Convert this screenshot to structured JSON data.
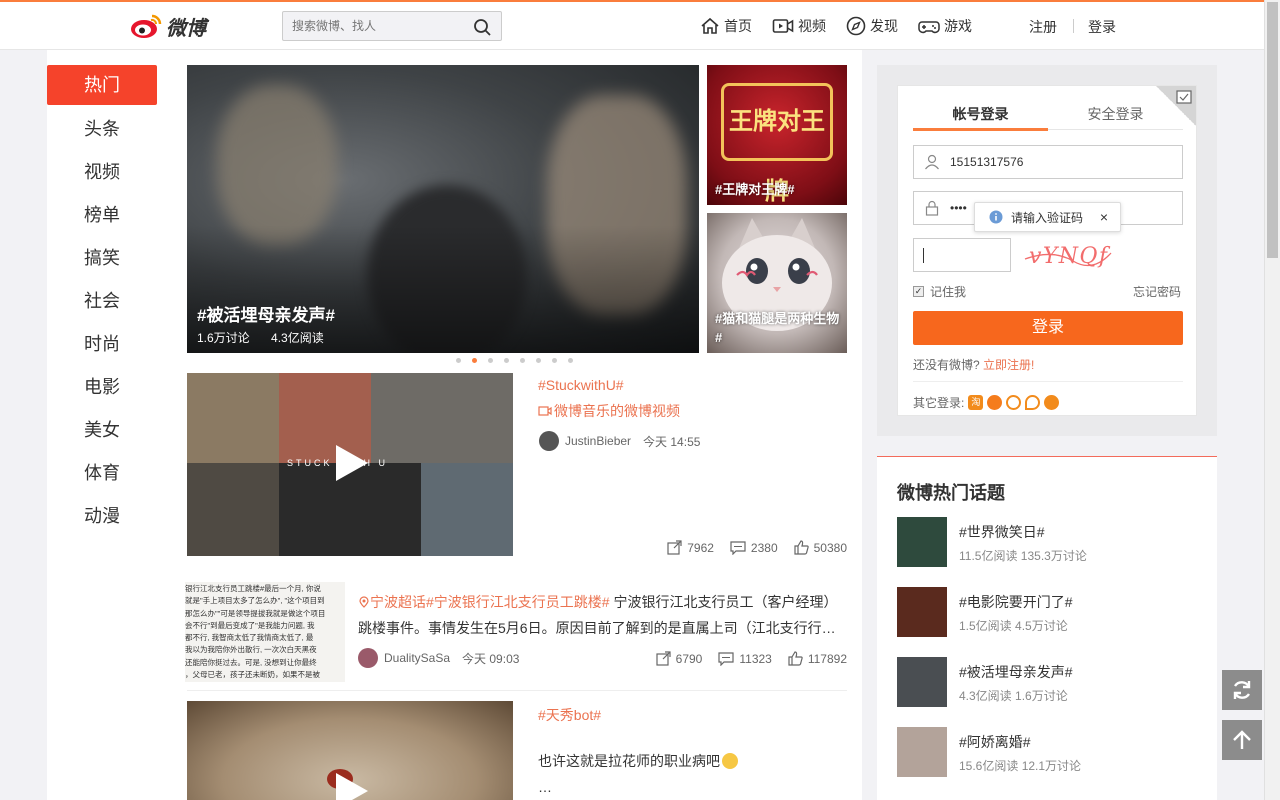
{
  "header": {
    "logo_text": "微博",
    "search_placeholder": "搜索微博、找人",
    "nav": [
      {
        "label": "首页",
        "icon": "home-icon"
      },
      {
        "label": "视频",
        "icon": "video-icon"
      },
      {
        "label": "发现",
        "icon": "compass-icon"
      },
      {
        "label": "游戏",
        "icon": "gamepad-icon"
      }
    ],
    "register": "注册",
    "login": "登录"
  },
  "sidebar": {
    "items": [
      "热门",
      "头条",
      "视频",
      "榜单",
      "搞笑",
      "社会",
      "时尚",
      "电影",
      "美女",
      "体育",
      "动漫"
    ],
    "active": "热门"
  },
  "hero": {
    "title": "#被活埋母亲发声#",
    "discussions": "1.6万讨论",
    "reads": "4.3亿阅读",
    "side1_caption": "#王牌对王牌#",
    "side1_logo": "王牌对王牌",
    "side2_caption": "#猫和猫腿是两种生物#",
    "carousel_count": 8,
    "carousel_active": 1
  },
  "feed": [
    {
      "tag": "#StuckwithU#",
      "sub": "微博音乐的微博视频",
      "user": "JustinBieber",
      "time": "今天 14:55",
      "overlay": "STUCK WITH U",
      "reposts": "7962",
      "comments": "2380",
      "likes": "50380"
    },
    {
      "tags_prefix": "宁波超话",
      "tag2": "#宁波银行江北支行员工跳楼#",
      "text_line1": " 宁波银行江北支行员工（客户经理）",
      "text_line2": "跳楼事件。事情发生在5月6日。原因目前了解到的是直属上司（江北支行行…",
      "user": "DualitySaSa",
      "time": "今天 09:03",
      "reposts": "6790",
      "comments": "11323",
      "likes": "117892",
      "thumb_lines": [
        "银行江北支行员工跳楼#最后一个月, 你说",
        "就是\"手上项目太多了怎么办\", \"这个项目到",
        "那怎么办\"\"可是领导提拔我就是做这个项目",
        "会不行\"到最后变成了\"是我能力问题, 我",
        "都不行, 我智商太低了我情商太低了, 最",
        "我以为我陪你外出散行, 一次次白天黑夜",
        "还能陪你挺过去。可是, 没想到让你最终",
        "，父母已老，孩子还未断奶，如果不是被"
      ]
    },
    {
      "tag": "#天秀bot#",
      "text": "也许这就是拉花师的职业病吧",
      "ellipsis": "…"
    }
  ],
  "login": {
    "tab_account": "帐号登录",
    "tab_secure": "安全登录",
    "username": "15151317576",
    "password_mask": "••••",
    "tooltip": "请输入验证码",
    "captcha_text": "vYNQf",
    "remember": "记住我",
    "forgot": "忘记密码",
    "button": "登录",
    "no_account": "还没有微博?",
    "register_now": "立即注册!",
    "other_login": "其它登录:"
  },
  "hot_topics": {
    "title": "微博热门话题",
    "items": [
      {
        "name": "#世界微笑日#",
        "meta": "11.5亿阅读 135.3万讨论",
        "color": "#2e4a3d"
      },
      {
        "name": "#电影院要开门了#",
        "meta": "1.5亿阅读 4.5万讨论",
        "color": "#5a2a1e"
      },
      {
        "name": "#被活埋母亲发声#",
        "meta": "4.3亿阅读 1.6万讨论",
        "color": "#4a4e52"
      },
      {
        "name": "#阿娇离婚#",
        "meta": "15.6亿阅读 12.1万讨论",
        "color": "#b3a39a"
      }
    ]
  },
  "colors": {
    "accent": "#fa7d3c",
    "tag": "#eb7350",
    "login_button": "#f7671d",
    "active_nav": "#f5432b"
  }
}
